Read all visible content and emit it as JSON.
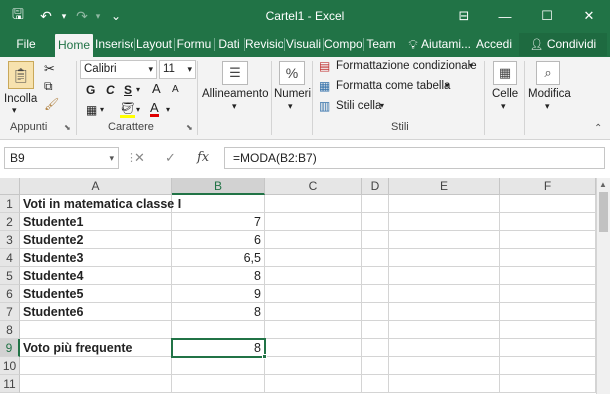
{
  "window": {
    "title": "Cartel1 - Excel",
    "minimize_glyph": "—",
    "restore_glyph": "☐",
    "close_glyph": "✕",
    "ribbon_opts_glyph": "⊟"
  },
  "quick_access": {
    "save_glyph": "🖫",
    "undo_glyph": "↶",
    "redo_glyph": "↷",
    "more_glyph": "⌄"
  },
  "tabs": [
    {
      "label": "File"
    },
    {
      "label": "Home"
    },
    {
      "label": "Inserisc"
    },
    {
      "label": "Layout"
    },
    {
      "label": "Formu"
    },
    {
      "label": "Dati"
    },
    {
      "label": "Revisio"
    },
    {
      "label": "Visuali"
    },
    {
      "label": "Compo"
    },
    {
      "label": "Team"
    }
  ],
  "tell_me": "Aiutami...",
  "signin": "Accedi",
  "share": "Condividi",
  "ribbon": {
    "clipboard": {
      "paste": "Incolla",
      "label": "Appunti"
    },
    "font": {
      "family": "Calibri",
      "size": "11",
      "label": "Carattere",
      "bold": "G",
      "italic": "C",
      "underline": "S",
      "grow": "A",
      "shrink": "A",
      "color_a": "A"
    },
    "alignment": {
      "label": "Allineamento"
    },
    "number": {
      "label": "Numeri",
      "icon": "%"
    },
    "styles": {
      "conditional": "Formattazione condizionale",
      "table": "Formatta come tabella",
      "cell": "Stili cella",
      "label": "Stili"
    },
    "cells": {
      "label": "Celle"
    },
    "editing": {
      "label": "Modifica"
    }
  },
  "formula_bar": {
    "name_box": "B9",
    "fx": "fx",
    "cancel": "✕",
    "enter": "✓",
    "formula": "=MODA(B2:B7)"
  },
  "grid": {
    "columns": [
      "A",
      "B",
      "C",
      "D",
      "E",
      "F"
    ],
    "rows": [
      "1",
      "2",
      "3",
      "4",
      "5",
      "6",
      "7",
      "8",
      "9",
      "10",
      "11"
    ],
    "selected_col": "B",
    "selected_row": "9",
    "cells": {
      "A1": "Voti in matematica classe I",
      "A2": "Studente1",
      "B2": "7",
      "A3": "Studente2",
      "B3": "6",
      "A4": "Studente3",
      "B4": "6,5",
      "A5": "Studente4",
      "B5": "8",
      "A6": "Studente5",
      "B6": "9",
      "A7": "Studente6",
      "B7": "8",
      "A9": "Voto più frequente",
      "B9": "8"
    }
  },
  "colors": {
    "excel_green": "#217346",
    "ribbon_bg": "#f3f3f3",
    "header_bg": "#e6e6e6"
  }
}
